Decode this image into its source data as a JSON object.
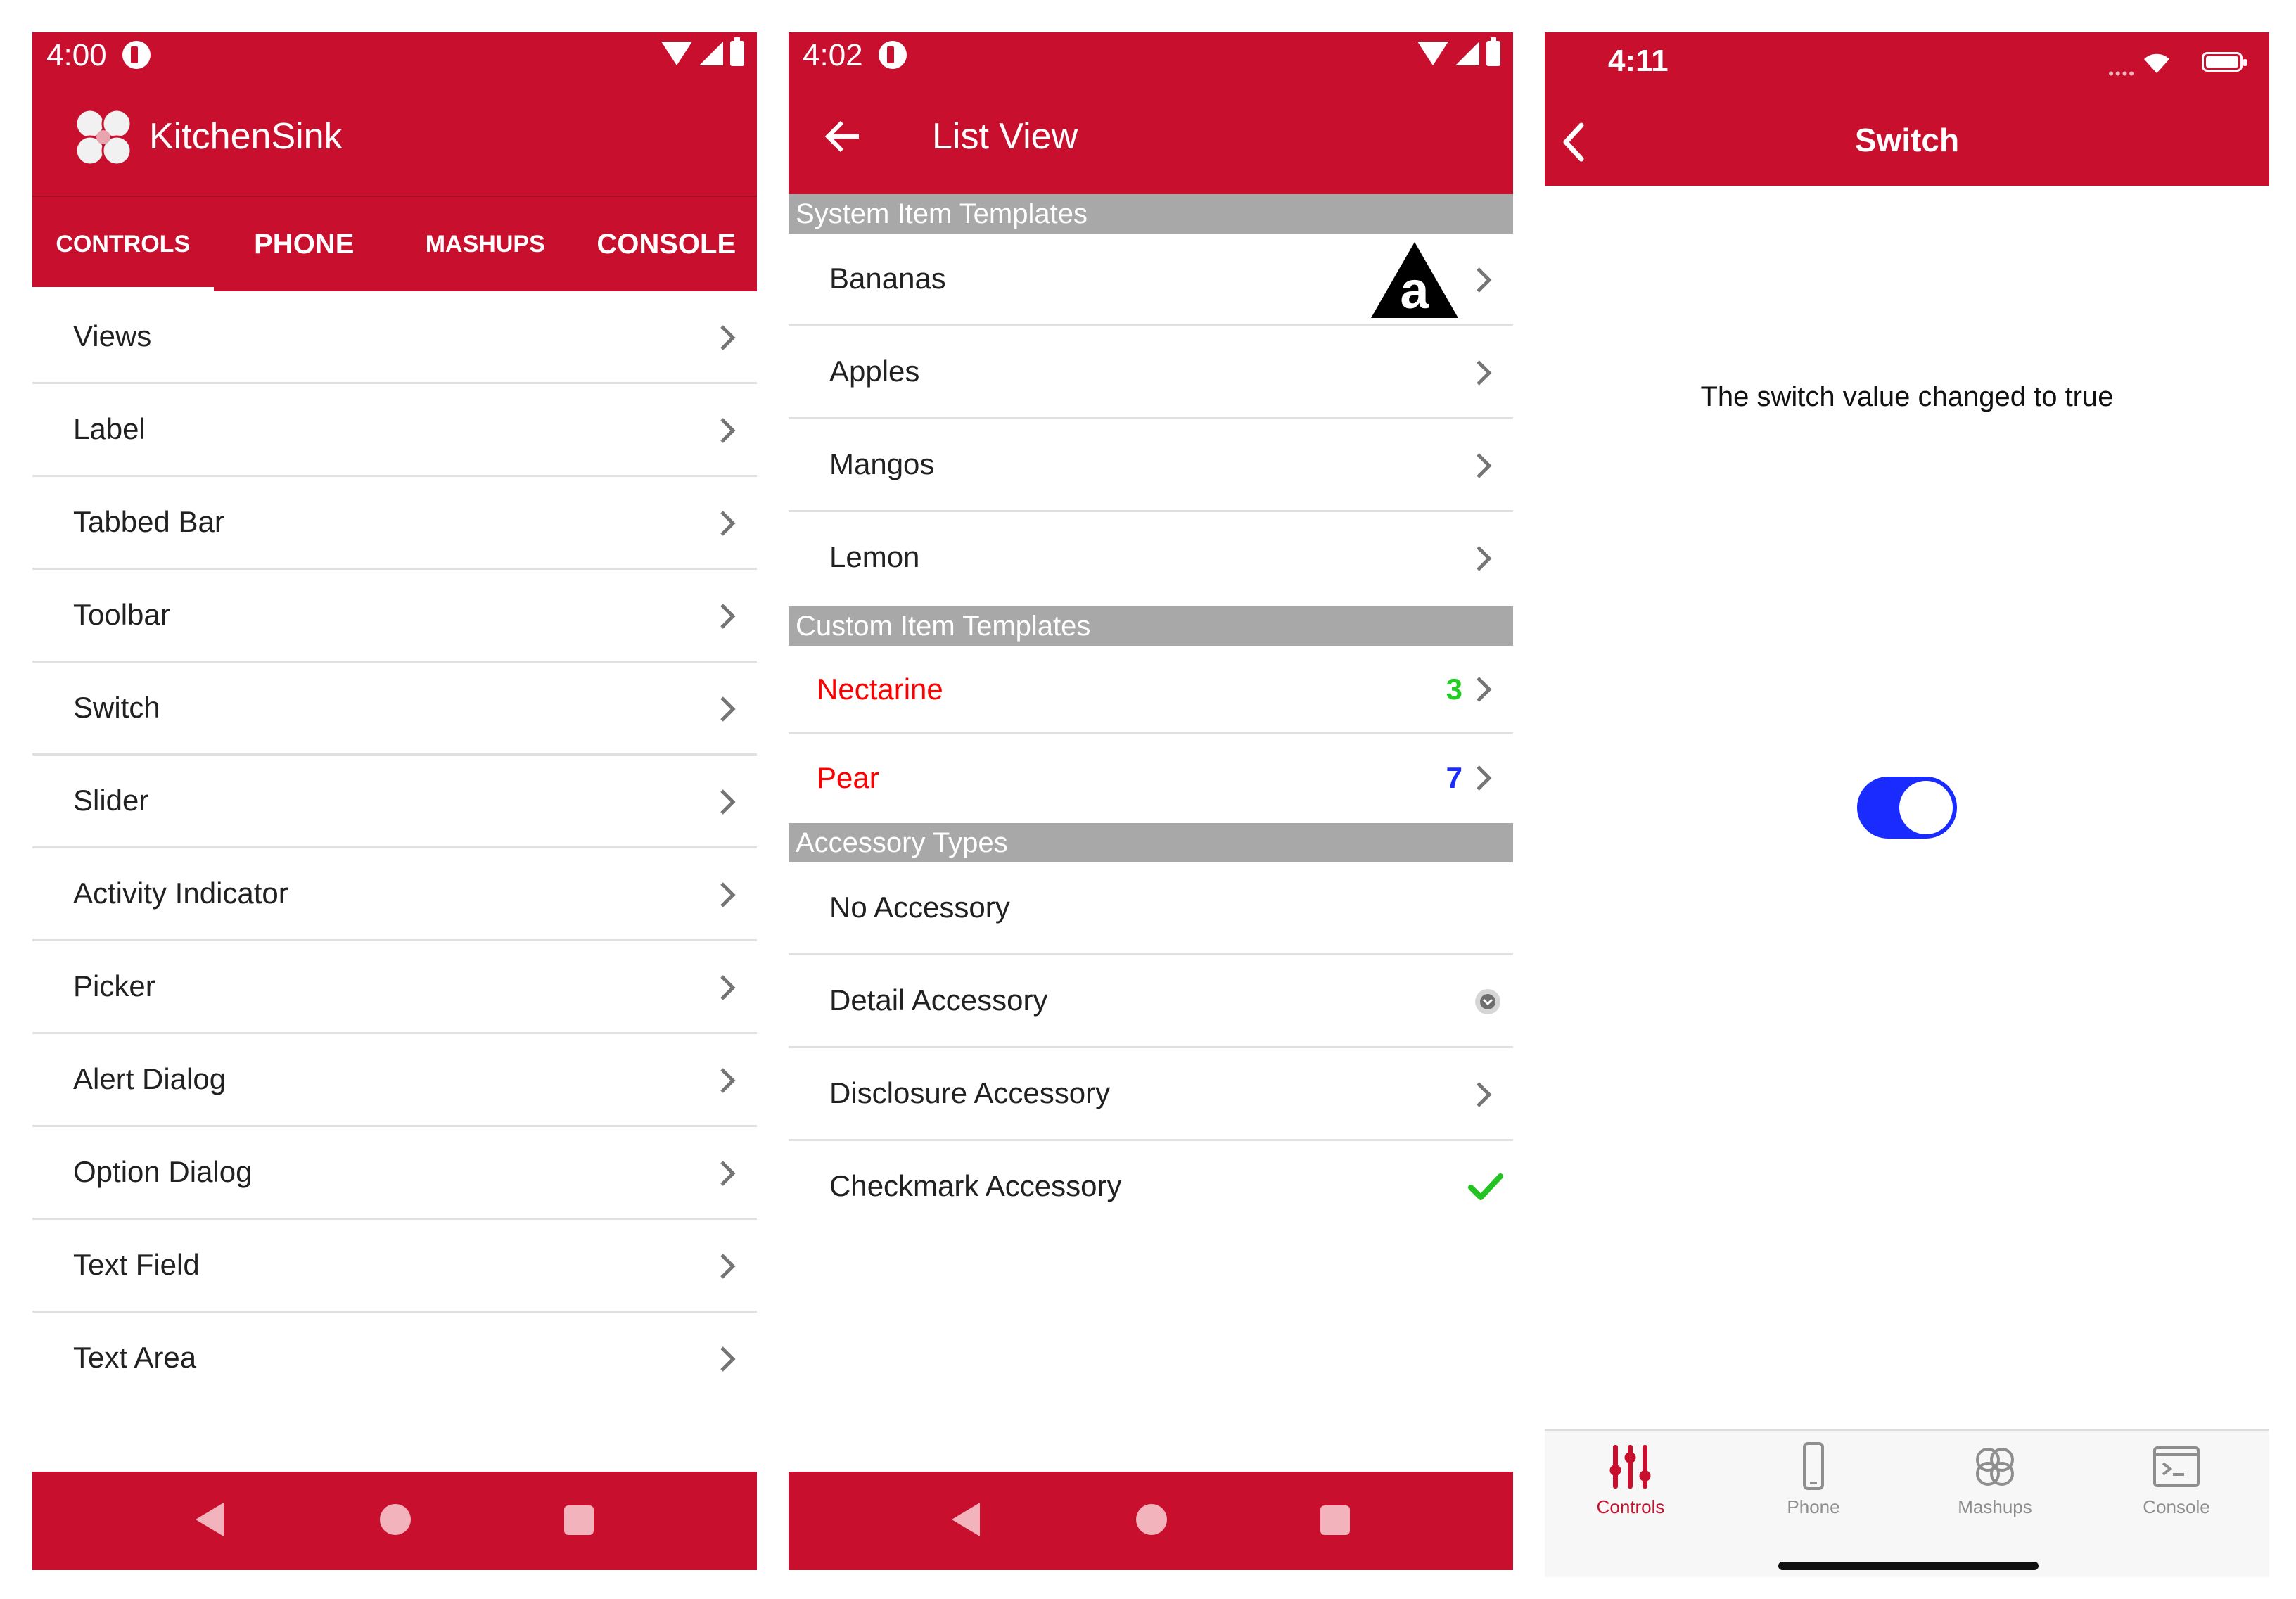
{
  "colors": {
    "brand_red": "#c8102e",
    "section_gray": "#a8a8a8",
    "switch_blue": "#1a2bff",
    "check_green": "#22c322",
    "custom_red": "#ff0000",
    "count_green": "#22cc22",
    "count_blue": "#1a2bff"
  },
  "screen1": {
    "status_time": "4:00",
    "app_title": "KitchenSink",
    "tabs": [
      "CONTROLS",
      "PHONE",
      "MASHUPS",
      "CONSOLE"
    ],
    "items": [
      "Views",
      "Label",
      "Tabbed Bar",
      "Toolbar",
      "Switch",
      "Slider",
      "Activity Indicator",
      "Picker",
      "Alert Dialog",
      "Option Dialog",
      "Text Field",
      "Text Area"
    ]
  },
  "screen2": {
    "status_time": "4:02",
    "title": "List View",
    "sections": {
      "system": "System Item Templates",
      "custom": "Custom Item Templates",
      "accessory": "Accessory Types"
    },
    "system_items": [
      "Bananas",
      "Apples",
      "Mangos",
      "Lemon"
    ],
    "custom_items": [
      {
        "label": "Nectarine",
        "count": "3"
      },
      {
        "label": "Pear",
        "count": "7"
      }
    ],
    "accessory_items": [
      "No Accessory",
      "Detail Accessory",
      "Disclosure Accessory",
      "Checkmark Accessory"
    ],
    "image_letter": "a"
  },
  "screen3": {
    "status_time": "4:11",
    "status_dots": "••••",
    "title": "Switch",
    "message": "The switch value changed to true",
    "switch_value": true,
    "tabbar": [
      "Controls",
      "Phone",
      "Mashups",
      "Console"
    ]
  }
}
